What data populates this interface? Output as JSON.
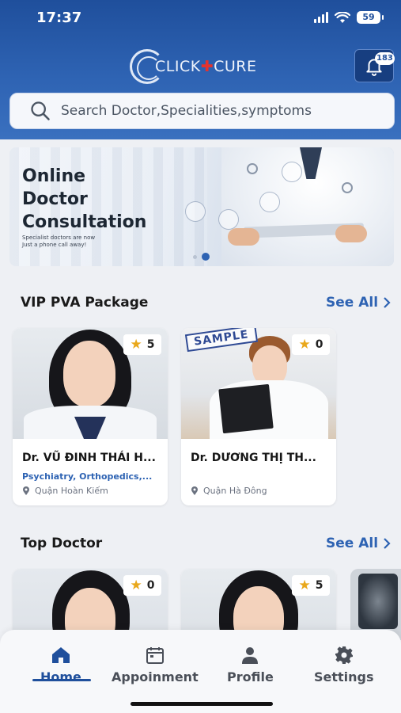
{
  "status_bar": {
    "time": "17:37",
    "battery": "59"
  },
  "header": {
    "logo_left": "CLICK",
    "logo_right": "CURE",
    "notification_count": "183",
    "search_placeholder": "Search Doctor,Specialities,symptoms"
  },
  "banner": {
    "title_line1": "Online",
    "title_line2": "Doctor",
    "title_line3": "Consultation",
    "subtitle_line1": "Specialist doctors are now",
    "subtitle_line2": "Just a phone call away!",
    "active_slide": 2
  },
  "vip_section": {
    "title": "VIP PVA Package",
    "see_all": "See All",
    "doctors": [
      {
        "name": "Dr. VŨ ĐINH THÁI H...",
        "specialty": "Psychiatry, Orthopedics,...",
        "location": "Quận Hoàn Kiếm",
        "rating": "5",
        "stamp": ""
      },
      {
        "name": "Dr. DƯƠNG THỊ TH...",
        "specialty": "",
        "location": "Quận Hà Đông",
        "rating": "0",
        "stamp": "SAMPLE"
      }
    ]
  },
  "top_section": {
    "title": "Top Doctor",
    "see_all": "See All",
    "doctors": [
      {
        "rating": "0"
      },
      {
        "rating": "5"
      }
    ]
  },
  "bottom_nav": {
    "items": [
      {
        "label": "Home",
        "icon": "home-icon",
        "active": true
      },
      {
        "label": "Appoinment",
        "icon": "calendar-icon",
        "active": false
      },
      {
        "label": "Profile",
        "icon": "person-icon",
        "active": false
      },
      {
        "label": "Settings",
        "icon": "gear-icon",
        "active": false
      }
    ]
  },
  "colors": {
    "brand": "#2e63b3",
    "header_dark": "#1f4f9c",
    "star": "#e9a81b"
  }
}
